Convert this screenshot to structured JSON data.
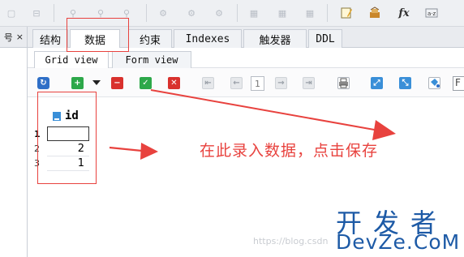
{
  "left_pane": {
    "tab_label": "号",
    "close_label": "×"
  },
  "tabs": [
    {
      "label": "结构"
    },
    {
      "label": "数据"
    },
    {
      "label": "约束"
    },
    {
      "label": "Indexes"
    },
    {
      "label": "触发器"
    },
    {
      "label": "DDL"
    }
  ],
  "active_tab": "数据",
  "subtabs": [
    {
      "label": "Grid view"
    },
    {
      "label": "Form view"
    }
  ],
  "grid_toolbar": {
    "page_number": "1",
    "filter_text": "F"
  },
  "grid": {
    "column": "id",
    "rows": [
      {
        "rownum": "1",
        "value": ""
      },
      {
        "rownum": "2",
        "value": "2"
      },
      {
        "rownum": "3",
        "value": "1"
      }
    ]
  },
  "annotation": "在此录入数据，点击保存",
  "logo": {
    "chinese": "开发者",
    "english": "DevZe.CoM"
  },
  "watermark": "https://blog.csdn",
  "colors": {
    "annotation_red": "#e8423e",
    "logo_blue": "#1d5aa6",
    "add_green": "#2da84a",
    "delete_red": "#d9312d",
    "save_green": "#2da84a"
  },
  "icons": {
    "top_toolbar": [
      "edit-icon",
      "delete-icon",
      "link-icon",
      "unlink-icon",
      "link-edit-icon",
      "gear-icon",
      "gear-icon",
      "gear-icon",
      "table-icon",
      "table-icon",
      "table-icon",
      "note-icon",
      "tools-icon",
      "fx-icon",
      "az-sort-icon"
    ]
  }
}
